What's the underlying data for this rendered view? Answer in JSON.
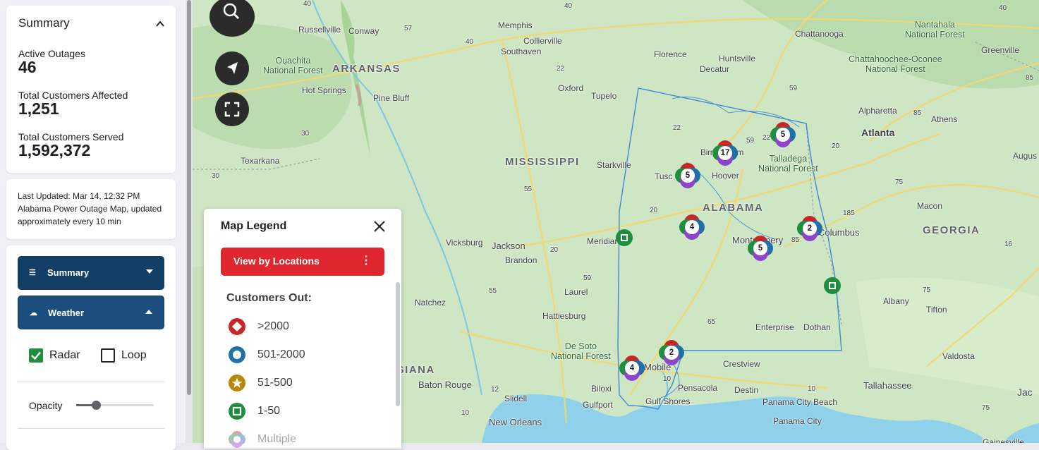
{
  "summary": {
    "title": "Summary",
    "active_outages_label": "Active Outages",
    "active_outages_value": "46",
    "customers_affected_label": "Total Customers Affected",
    "customers_affected_value": "1,251",
    "customers_served_label": "Total Customers Served",
    "customers_served_value": "1,592,372"
  },
  "updated": {
    "last_updated": "Last Updated:  Mar 14, 12:32 PM",
    "description": "Alabama Power Outage Map, updated approximately every 10 min"
  },
  "controls": {
    "summary_label": "Summary",
    "weather_label": "Weather",
    "radar_label": "Radar",
    "radar_checked": true,
    "loop_label": "Loop",
    "loop_checked": false,
    "opacity_label": "Opacity",
    "opacity_value": 0.25
  },
  "legend": {
    "title": "Map Legend",
    "view_button": "View by Locations",
    "customers_out_label": "Customers Out:",
    "items": [
      {
        "label": ">2000",
        "icon": "red-diamond-icon",
        "color": "#c62828"
      },
      {
        "label": "501-2000",
        "icon": "blue-circle-icon",
        "color": "#1f6fa8"
      },
      {
        "label": "51-500",
        "icon": "gold-star-icon",
        "color": "#b8860b"
      },
      {
        "label": "1-50",
        "icon": "green-square-icon",
        "color": "#1e8e3e"
      },
      {
        "label": "Multiple",
        "icon": "multi-color-icon",
        "color": "#9aa0a6"
      }
    ]
  },
  "map": {
    "states": [
      "ARKANSAS",
      "MISSISSIPPI",
      "ALABAMA",
      "GEORGIA",
      "ISIANA"
    ],
    "parks": [
      "Ouachita\nNational Forest",
      "Talladega\nNational Forest",
      "De Soto\nNational Forest",
      "Nantahala\nNational Forest",
      "Chattahoochee-Oconee\nNational Forest"
    ],
    "cities": [
      "Russellville",
      "Conway",
      "Memphis",
      "Collierville",
      "Southaven",
      "Hot Springs",
      "Pine Bluff",
      "Oxford",
      "Tupelo",
      "Florence",
      "Huntsville",
      "Decatur",
      "Chattanooga",
      "Greenville",
      "Alpharetta",
      "Athens",
      "Atlanta",
      "Augus",
      "Texarkana",
      "Starkville",
      "Tusc",
      "Hoover",
      "Birmingham",
      "Vicksburg",
      "Jackson",
      "Brandon",
      "Meridian",
      "Montgomery",
      "Columbus",
      "Macon",
      "Natchez",
      "Laurel",
      "Hattiesburg",
      "Enterprise",
      "Dothan",
      "Albany",
      "Tifton",
      "Valdosta",
      "Baton Rouge",
      "Biloxi",
      "Gulfport",
      "Slidell",
      "Mobile",
      "Pensacola",
      "Destin",
      "Panama City Beach",
      "Panama City",
      "Crestview",
      "Gulf Shores",
      "Tallahassee",
      "New Orleans",
      "Jac",
      "Gainesville"
    ],
    "clusters": [
      "5",
      "17",
      "5",
      "4",
      "2",
      "5",
      "2",
      "4"
    ],
    "highways": [
      "40",
      "40",
      "40",
      "57",
      "40",
      "22",
      "59",
      "85",
      "85",
      "30",
      "30",
      "22",
      "22",
      "59",
      "20",
      "75",
      "55",
      "20",
      "20",
      "185",
      "85",
      "59",
      "55",
      "65",
      "75",
      "16",
      "12",
      "10",
      "10",
      "75",
      "10"
    ]
  }
}
